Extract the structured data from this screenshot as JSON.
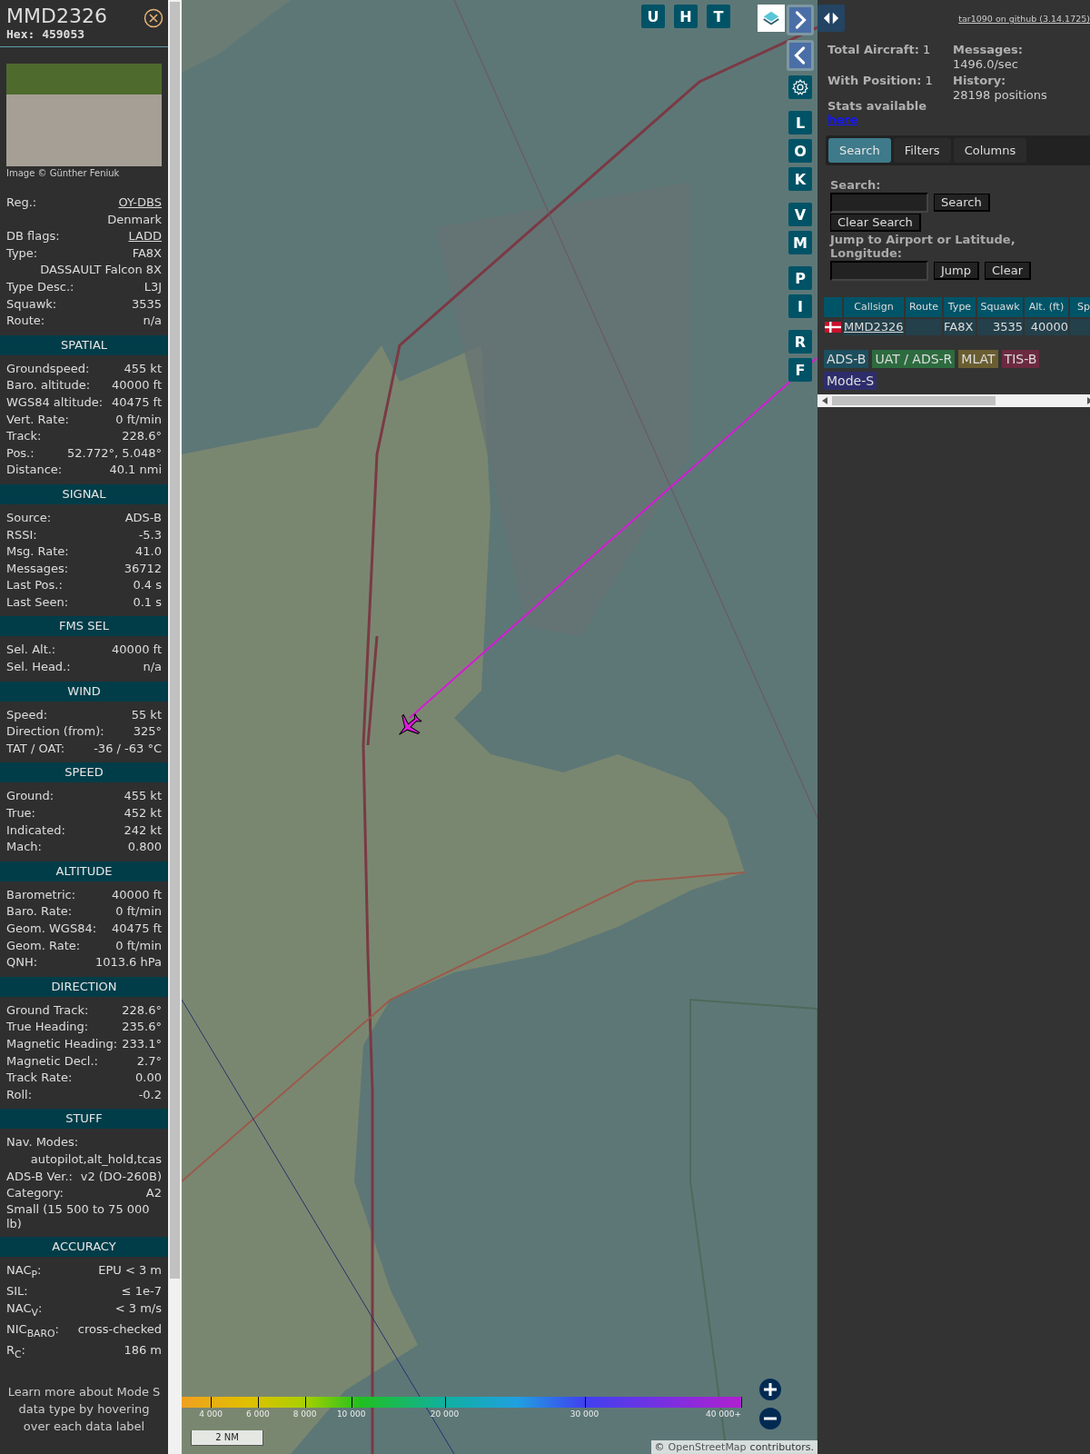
{
  "details": {
    "callsign": "MMD2326",
    "hex_line": "Hex: 459053",
    "photo_credit": "Image © Günther Feniuk",
    "rows": [
      {
        "kind": "pair",
        "label": "Reg.:",
        "value": "OY-DBS",
        "link": true
      },
      {
        "kind": "note",
        "value": "Denmark"
      },
      {
        "kind": "pair",
        "label": "DB flags:",
        "value": "LADD",
        "link": true
      },
      {
        "kind": "pair",
        "label": "Type:",
        "value": "FA8X",
        "link": false
      },
      {
        "kind": "note",
        "value": "DASSAULT Falcon 8X"
      },
      {
        "kind": "pair",
        "label": "Type Desc.:",
        "value": "L3J",
        "link": false
      },
      {
        "kind": "pair",
        "label": "Squawk:",
        "value": "3535",
        "link": false
      },
      {
        "kind": "pair",
        "label": "Route:",
        "value": "n/a",
        "link": false
      }
    ]
  },
  "sections": [
    {
      "title": "SPATIAL",
      "rows": [
        {
          "kind": "pair",
          "label": "Groundspeed:",
          "value": "455 kt"
        },
        {
          "kind": "pair",
          "label": "Baro. altitude:",
          "value": "40000 ft"
        },
        {
          "kind": "pair",
          "label": "WGS84 altitude:",
          "value": "40475 ft"
        },
        {
          "kind": "pair",
          "label": "Vert. Rate:",
          "value": "0 ft/min"
        },
        {
          "kind": "pair",
          "label": "Track:",
          "value": "228.6°"
        },
        {
          "kind": "pair",
          "label": "Pos.:",
          "value": "52.772°, 5.048°"
        },
        {
          "kind": "pair",
          "label": "Distance:",
          "value": "40.1 nmi"
        }
      ]
    },
    {
      "title": "SIGNAL",
      "rows": [
        {
          "kind": "pair",
          "label": "Source:",
          "value": "ADS-B"
        },
        {
          "kind": "pair",
          "label": "RSSI:",
          "value": "-5.3"
        },
        {
          "kind": "pair",
          "label": "Msg. Rate:",
          "value": "41.0"
        },
        {
          "kind": "pair",
          "label": "Messages:",
          "value": "36712"
        },
        {
          "kind": "pair",
          "label": "Last Pos.:",
          "value": "0.4 s"
        },
        {
          "kind": "pair",
          "label": "Last Seen:",
          "value": "0.1 s"
        }
      ]
    },
    {
      "title": "FMS SEL",
      "rows": [
        {
          "kind": "pair",
          "label": "Sel. Alt.:",
          "value": "40000 ft"
        },
        {
          "kind": "pair",
          "label": "Sel. Head.:",
          "value": "n/a"
        }
      ]
    },
    {
      "title": "WIND",
      "rows": [
        {
          "kind": "pair",
          "label": "Speed:",
          "value": "55 kt"
        },
        {
          "kind": "pair",
          "label": "Direction (from):",
          "value": "325°"
        },
        {
          "kind": "pair",
          "label": "TAT / OAT:",
          "value": "-36 / -63 °C"
        }
      ]
    },
    {
      "title": "SPEED",
      "rows": [
        {
          "kind": "pair",
          "label": "Ground:",
          "value": "455 kt"
        },
        {
          "kind": "pair",
          "label": "True:",
          "value": "452 kt"
        },
        {
          "kind": "pair",
          "label": "Indicated:",
          "value": "242 kt"
        },
        {
          "kind": "pair",
          "label": "Mach:",
          "value": "0.800"
        }
      ]
    },
    {
      "title": "ALTITUDE",
      "rows": [
        {
          "kind": "pair",
          "label": "Barometric:",
          "value": "40000 ft"
        },
        {
          "kind": "pair",
          "label": "Baro. Rate:",
          "value": "0 ft/min"
        },
        {
          "kind": "pair",
          "label": "Geom. WGS84:",
          "value": "40475 ft"
        },
        {
          "kind": "pair",
          "label": "Geom. Rate:",
          "value": "0 ft/min"
        },
        {
          "kind": "pair",
          "label": "QNH:",
          "value": "1013.6 hPa"
        }
      ]
    },
    {
      "title": "DIRECTION",
      "rows": [
        {
          "kind": "pair",
          "label": "Ground Track:",
          "value": "228.6°"
        },
        {
          "kind": "pair",
          "label": "True Heading:",
          "value": "235.6°"
        },
        {
          "kind": "pair",
          "label": "Magnetic Heading:",
          "value": "233.1°"
        },
        {
          "kind": "pair",
          "label": "Magnetic Decl.:",
          "value": "2.7°"
        },
        {
          "kind": "pair",
          "label": "Track Rate:",
          "value": "0.00"
        },
        {
          "kind": "pair",
          "label": "Roll:",
          "value": "-0.2"
        }
      ]
    },
    {
      "title": "STUFF",
      "rows": [
        {
          "kind": "pair",
          "label": "Nav. Modes:",
          "value": ""
        },
        {
          "kind": "note",
          "value": "autopilot,alt_hold,tcas"
        },
        {
          "kind": "pair",
          "label": "ADS-B Ver.:",
          "value": "v2 (DO-260B)"
        },
        {
          "kind": "pair",
          "label": "Category:",
          "value": "A2"
        },
        {
          "kind": "text",
          "value": "Small (15 500 to 75 000 lb)"
        }
      ]
    },
    {
      "title": "ACCURACY",
      "rows": [
        {
          "kind": "pair",
          "label": "NAC$_{P}$:",
          "value": "EPU < 3 m"
        },
        {
          "kind": "pair",
          "label": "SIL:",
          "value": "≤ 1e-7"
        },
        {
          "kind": "pair",
          "label": "NAC$_{V}$:",
          "value": "< 3 m/s"
        },
        {
          "kind": "pair",
          "label": "NIC$_{BARO}$:",
          "value": "cross-checked"
        },
        {
          "kind": "pair",
          "label": "R$_{C}$:",
          "value": "186 m"
        }
      ]
    }
  ],
  "footer_note": "Learn more about Mode S data type by hovering over each data label",
  "map": {
    "top_buttons": [
      "U",
      "H",
      "T"
    ],
    "side_groups": [
      [
        "L",
        "O",
        "K"
      ],
      [
        "V",
        "M"
      ],
      [
        "P",
        "I"
      ],
      [
        "R",
        "F"
      ]
    ],
    "altitude_legend": [
      "4 000",
      "6 000",
      "8 000",
      "10 000",
      "20 000",
      "30 000",
      "40 000+"
    ],
    "scale": "2 NM",
    "attribution_prefix": "©",
    "attribution_link": "OpenStreetMap",
    "attribution_suffix": "contributors."
  },
  "panel": {
    "version_link": "tar1090 on github (3.14.1725)",
    "stats_left": [
      {
        "label": "Total Aircraft:",
        "value": "1"
      },
      {
        "label": "With Position:",
        "value": "1"
      }
    ],
    "stats_note": "Stats available",
    "stats_link": "here",
    "stats_right": [
      {
        "label": "Messages:",
        "value": "1496.0/sec"
      },
      {
        "label": "History:",
        "value": "28198 positions"
      }
    ],
    "tabs": [
      {
        "label": "Search",
        "selected": true
      },
      {
        "label": "Filters",
        "selected": false
      },
      {
        "label": "Columns",
        "selected": false
      }
    ],
    "search_label": "Search:",
    "search_button": "Search",
    "clear_search_button": "Clear Search",
    "jump_label": "Jump to Airport or Latitude, Longitude:",
    "jump_button": "Jump",
    "clear_button": "Clear",
    "table": {
      "columns": [
        "Callsign",
        "Route",
        "Type",
        "Squawk",
        "Alt. (ft)",
        "Sp"
      ],
      "rows": [
        {
          "callsign": "MMD2326",
          "type": "FA8X",
          "squawk": "3535",
          "altitude": "40000"
        }
      ]
    },
    "sources": [
      {
        "label": "ADS-B",
        "color": "#1d4e5e"
      },
      {
        "label": "UAT / ADS-R",
        "color": "#2d6b3f"
      },
      {
        "label": "MLAT",
        "color": "#6a5d31"
      },
      {
        "label": "TIS-B",
        "color": "#6b2a40"
      },
      {
        "label": "Mode-S",
        "color": "#2e2d6c"
      }
    ]
  }
}
